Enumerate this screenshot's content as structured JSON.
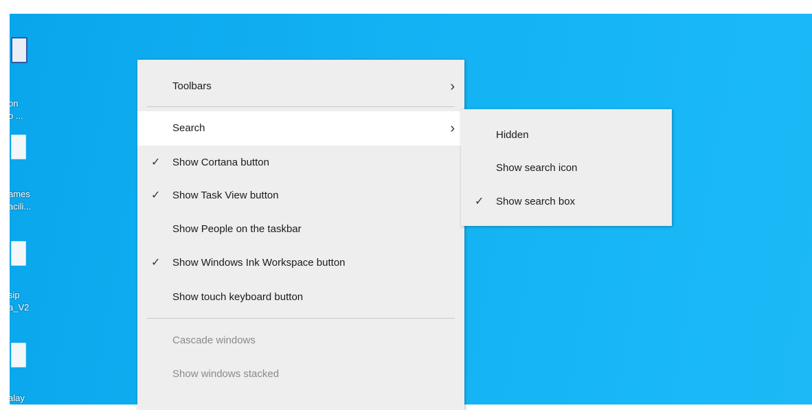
{
  "desktop_icons": [
    {
      "line1": "on",
      "line2": "o ..."
    },
    {
      "line1": "ames",
      "line2": "acili..."
    },
    {
      "line1": "sip",
      "line2": "a_V2"
    },
    {
      "line1": "alay",
      "line2": ""
    }
  ],
  "taskbar_menu": {
    "toolbars": {
      "label": "Toolbars"
    },
    "search": {
      "label": "Search"
    },
    "cortana": {
      "label": "Show Cortana button",
      "checked": true
    },
    "task_view": {
      "label": "Show Task View button",
      "checked": true
    },
    "people": {
      "label": "Show People on the taskbar",
      "checked": false
    },
    "ink": {
      "label": "Show Windows Ink Workspace button",
      "checked": true
    },
    "touch_keyboard": {
      "label": "Show touch keyboard button",
      "checked": false
    },
    "cascade": {
      "label": "Cascade windows"
    },
    "stacked": {
      "label": "Show windows stacked"
    }
  },
  "search_submenu": {
    "hidden": {
      "label": "Hidden",
      "checked": false
    },
    "icon": {
      "label": "Show search icon",
      "checked": false
    },
    "box": {
      "label": "Show search box",
      "checked": true
    }
  },
  "glyphs": {
    "check": "✓",
    "chevron": "›"
  }
}
